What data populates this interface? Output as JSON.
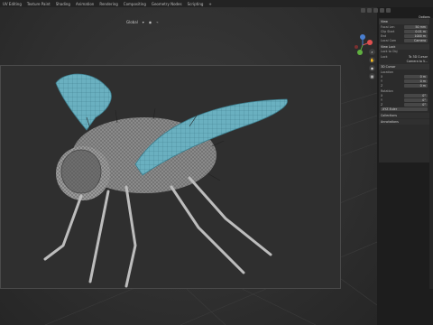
{
  "menu": {
    "tabs": [
      "UV Editing",
      "Texture Paint",
      "Shading",
      "Animation",
      "Rendering",
      "Compositing",
      "Geometry Nodes",
      "Scripting"
    ],
    "add": "+"
  },
  "viewport": {
    "mode_labels": [
      "Global",
      "▾",
      "◉",
      "⌁"
    ]
  },
  "npanel": {
    "options_label": "Options",
    "view_section": "View",
    "view_rows": [
      {
        "label": "Focal Len",
        "value": "50 mm"
      },
      {
        "label": "Clip Start",
        "value": "0.01 m"
      },
      {
        "label": "End",
        "value": "1000 m"
      },
      {
        "label": "Local Cam",
        "value": "Camera"
      }
    ],
    "view_lock": "View Lock",
    "lock_rows": [
      {
        "label": "Lock to Obj",
        "value": ""
      },
      {
        "label": "Lock",
        "value": "To 3D Cursor"
      },
      {
        "label": "",
        "value": "Camera to V..."
      }
    ],
    "cursor_section": "3D Cursor",
    "location_label": "Location",
    "location": [
      {
        "axis": "X",
        "value": "0 m"
      },
      {
        "axis": "Y",
        "value": "0 m"
      },
      {
        "axis": "Z",
        "value": "0 m"
      }
    ],
    "rotation_label": "Rotation",
    "rotation": [
      {
        "axis": "X",
        "value": "0°"
      },
      {
        "axis": "Y",
        "value": "0°"
      },
      {
        "axis": "Z",
        "value": "0°"
      }
    ],
    "rotation_mode": "XYZ Euler",
    "collapsed": [
      "Collections",
      "Annotations"
    ]
  }
}
